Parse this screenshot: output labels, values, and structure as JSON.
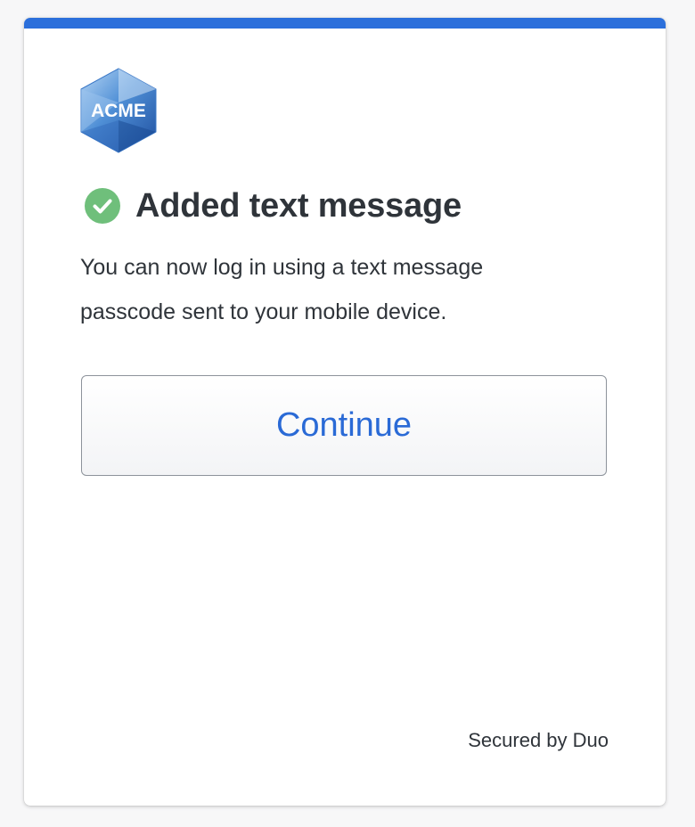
{
  "colors": {
    "accent": "#2b6fdb",
    "success": "#6fbf7b",
    "primary_text": "#2f343a",
    "link": "#2a6ad6"
  },
  "logo": {
    "text": "ACME",
    "icon": "acme-hexagon-logo"
  },
  "status": {
    "icon": "check-circle-icon",
    "heading": "Added text message"
  },
  "message": {
    "body": "You can now log in using a text message passcode sent to your mobile device."
  },
  "actions": {
    "continue_label": "Continue"
  },
  "footer": {
    "secured_by": "Secured by Duo"
  }
}
